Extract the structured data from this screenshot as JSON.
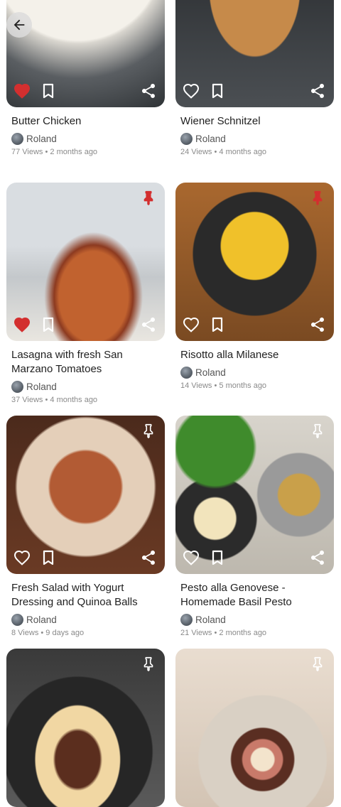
{
  "back_label": "Back",
  "cards": [
    {
      "title": "Butter Chicken",
      "author": "Roland",
      "meta": "77 Views • 2 months ago",
      "liked": true,
      "pinned": null,
      "bg": "butter"
    },
    {
      "title": "Wiener Schnitzel",
      "author": "Roland",
      "meta": "24 Views • 4 months ago",
      "liked": false,
      "pinned": null,
      "bg": "schnitzel"
    },
    {
      "title": "Lasagna with fresh San Marzano Tomatoes",
      "author": "Roland",
      "meta": "37 Views • 4 months ago",
      "liked": true,
      "pinned": true,
      "bg": "lasagna"
    },
    {
      "title": "Risotto alla Milanese",
      "author": "Roland",
      "meta": "14 Views • 5 months ago",
      "liked": false,
      "pinned": true,
      "bg": "risotto"
    },
    {
      "title": "Fresh Salad with Yogurt Dressing and Quinoa Balls",
      "author": "Roland",
      "meta": "8 Views • 9 days ago",
      "liked": false,
      "pinned": false,
      "bg": "salad"
    },
    {
      "title": "Pesto alla Genovese - Homemade Basil Pesto",
      "author": "Roland",
      "meta": "21 Views • 2 months ago",
      "liked": false,
      "pinned": false,
      "bg": "pesto"
    },
    {
      "title": "",
      "author": "",
      "meta": "",
      "liked": false,
      "pinned": false,
      "bg": "steak"
    },
    {
      "title": "",
      "author": "",
      "meta": "",
      "liked": false,
      "pinned": false,
      "bg": "fudge"
    }
  ],
  "colors": {
    "liked": "#d32f2f",
    "pinned": "#d32f2f",
    "icon": "#ffffff"
  }
}
